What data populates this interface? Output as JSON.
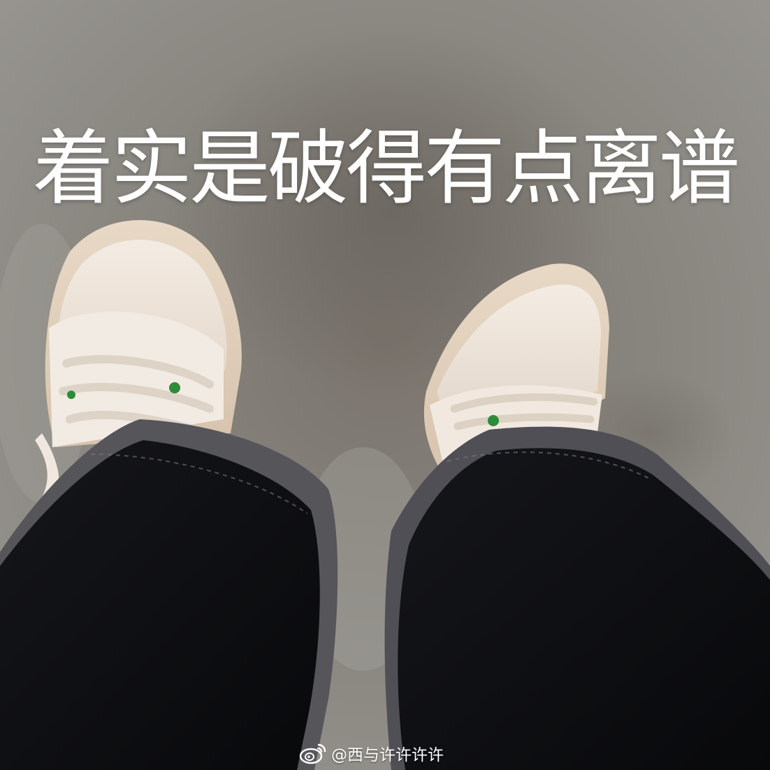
{
  "caption": "着实是破得有点离谱",
  "watermark": {
    "handle": "@西与许许许许",
    "icon": "weibo-logo-icon"
  },
  "palette": {
    "floor": "#8f8c87",
    "floor_dark": "#6b6660",
    "trousers": "#0e0f12",
    "shoe_canvas": "#efe6dd",
    "eyelet_green": "#2e8b3a",
    "text": "#ffffff"
  }
}
